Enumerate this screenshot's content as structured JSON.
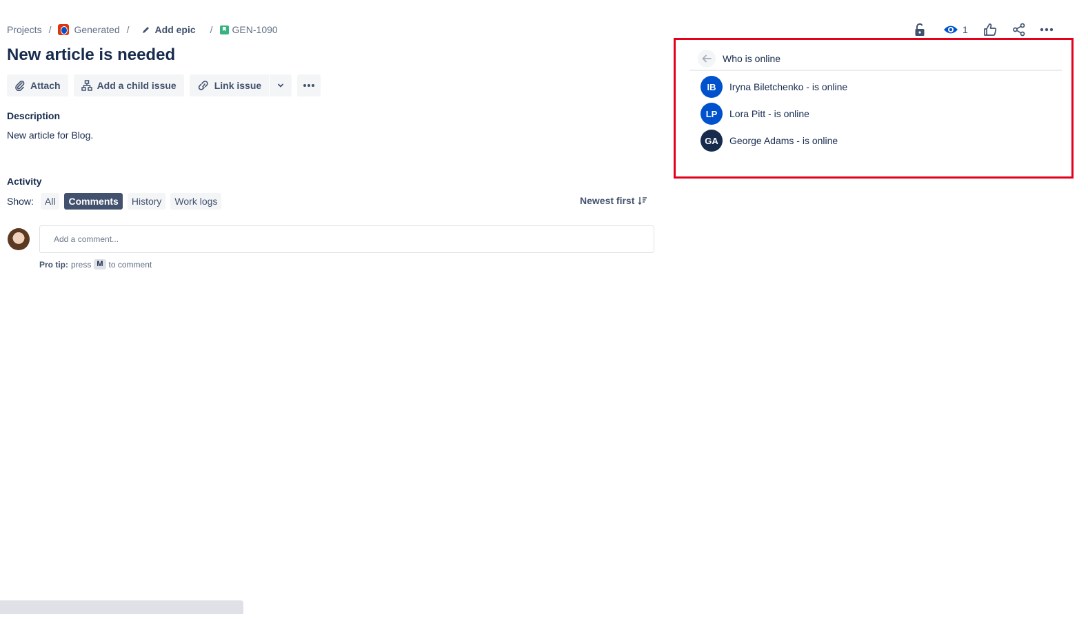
{
  "breadcrumb": {
    "projects": "Projects",
    "project": "Generated",
    "epic": "Add epic",
    "issue_key": "GEN-1090",
    "separator": "/"
  },
  "issue": {
    "title": "New article is needed"
  },
  "toolbar": {
    "attach": "Attach",
    "add_child": "Add a child issue",
    "link_issue": "Link issue"
  },
  "description": {
    "label": "Description",
    "text": "New article for Blog."
  },
  "activity": {
    "label": "Activity",
    "show_label": "Show:",
    "filters": [
      "All",
      "Comments",
      "History",
      "Work logs"
    ],
    "active_filter": "Comments",
    "sort_label": "Newest first"
  },
  "comment": {
    "placeholder": "Add a comment...",
    "protip_prefix": "Pro tip:",
    "protip_press": "press",
    "protip_key": "M",
    "protip_suffix": "to comment"
  },
  "header_actions": {
    "watch_count": "1"
  },
  "online_panel": {
    "title": "Who is online",
    "users": [
      {
        "initials": "IB",
        "label": "Iryna Biletchenko - is online",
        "color": "#0052cc"
      },
      {
        "initials": "LP",
        "label": "Lora Pitt - is online",
        "color": "#0052cc"
      },
      {
        "initials": "GA",
        "label": "George Adams - is online",
        "color": "#172b4d"
      }
    ]
  },
  "colors": {
    "highlight_border": "#e3001b",
    "active_filter": "#42526e",
    "watch_icon": "#0052cc"
  }
}
